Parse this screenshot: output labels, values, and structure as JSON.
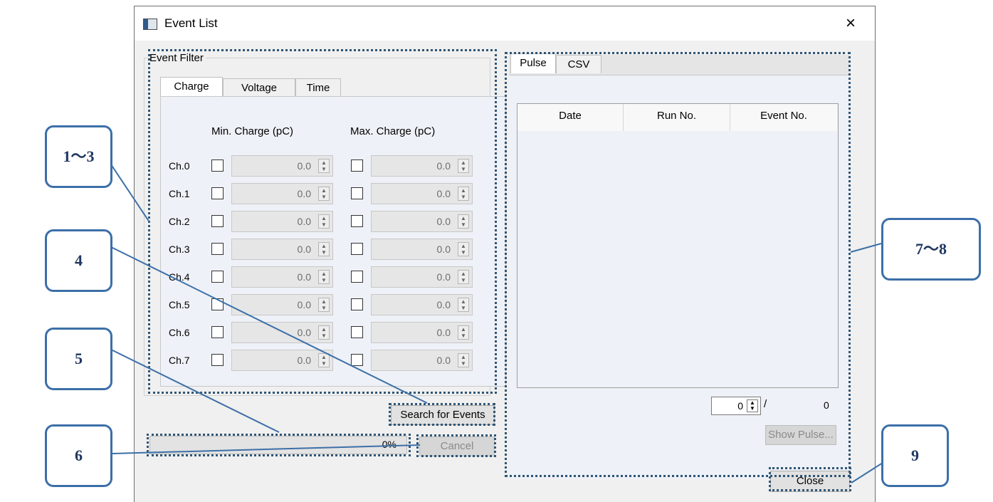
{
  "window": {
    "title": "Event List",
    "close_glyph": "×"
  },
  "event_filter": {
    "group_label": "Event Filter",
    "tabs": [
      "Charge",
      "Voltage",
      "Time"
    ],
    "active_tab": "Charge",
    "min_header": "Min. Charge (pC)",
    "max_header": "Max. Charge (pC)",
    "channels": [
      {
        "label": "Ch.0",
        "min": "0.0",
        "max": "0.0"
      },
      {
        "label": "Ch.1",
        "min": "0.0",
        "max": "0.0"
      },
      {
        "label": "Ch.2",
        "min": "0.0",
        "max": "0.0"
      },
      {
        "label": "Ch.3",
        "min": "0.0",
        "max": "0.0"
      },
      {
        "label": "Ch.4",
        "min": "0.0",
        "max": "0.0"
      },
      {
        "label": "Ch.5",
        "min": "0.0",
        "max": "0.0"
      },
      {
        "label": "Ch.6",
        "min": "0.0",
        "max": "0.0"
      },
      {
        "label": "Ch.7",
        "min": "0.0",
        "max": "0.0"
      }
    ],
    "search_button": "Search for Events"
  },
  "progress": {
    "percent_text": "0%",
    "value": 0
  },
  "cancel_button": "Cancel",
  "results": {
    "tabs": [
      "Pulse",
      "CSV"
    ],
    "active_tab": "Pulse",
    "columns": [
      "Date",
      "Run No.",
      "Event No."
    ],
    "pager_value": "0",
    "pager_separator": "/",
    "pager_total": "0",
    "show_pulse_button": "Show Pulse..."
  },
  "close_button": "Close",
  "callouts": [
    "1～3",
    "4",
    "5",
    "6",
    "7～8",
    "9"
  ],
  "colors": {
    "annotation_border": "#3c6fa8",
    "highlight_dots": "#2f5574",
    "panel_bg": "#eef1f7"
  }
}
